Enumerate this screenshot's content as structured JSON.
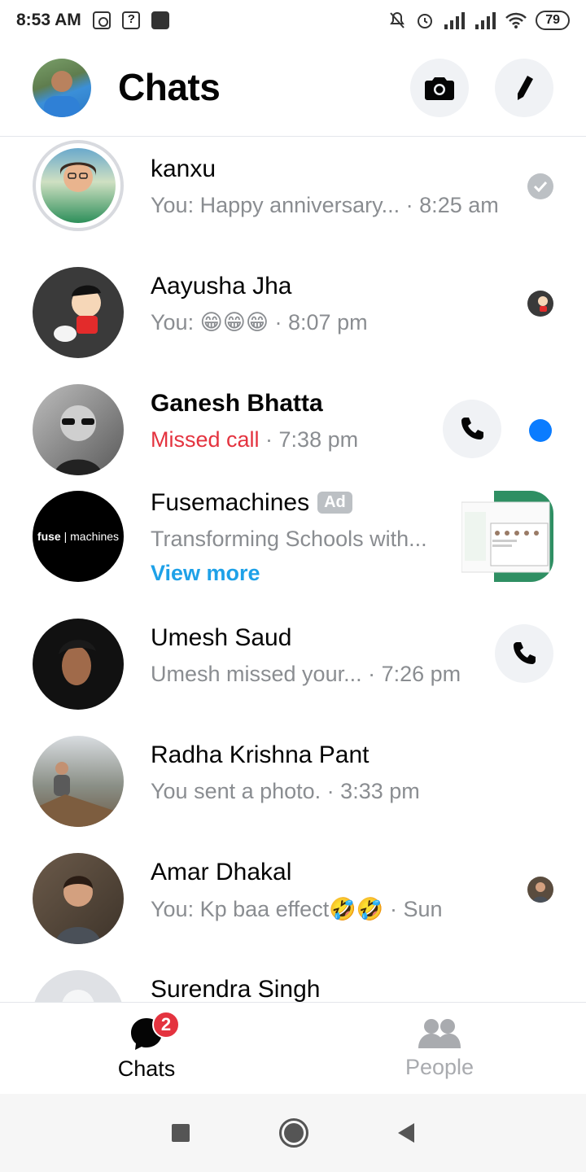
{
  "status_bar": {
    "time": "8:53 AM",
    "battery": "79",
    "icons": [
      "instagram-icon",
      "maps-icon",
      "game-icon",
      "mute-icon",
      "alarm-icon",
      "signal-icon",
      "signal-icon",
      "wifi-icon",
      "battery-icon"
    ]
  },
  "header": {
    "title": "Chats",
    "camera_icon": "camera-icon",
    "compose_icon": "pencil-icon"
  },
  "chats": [
    {
      "name": "kanxu",
      "preview": "You: Happy anniversary... · 8:25 am",
      "indicator": "seen-check-icon"
    },
    {
      "name": "Aayusha Jha",
      "preview_prefix": "You: ",
      "emoji": "😁😁😁",
      "preview_suffix": " · 8:07 pm",
      "indicator": "seen-avatar"
    },
    {
      "name": "Ganesh Bhatta",
      "missed": "Missed call",
      "preview_suffix": " · 7:38 pm",
      "indicator": "unread-dot",
      "action": "phone-icon"
    },
    {
      "name": "Fusemachines",
      "ad_badge": "Ad",
      "preview": "Transforming Schools with...",
      "link": "View more",
      "avatar_text_bold": "fuse",
      "avatar_text": "machines"
    },
    {
      "name": "Umesh Saud",
      "preview": "Umesh missed your...  · 7:26 pm",
      "action": "phone-icon"
    },
    {
      "name": "Radha Krishna Pant",
      "preview": "You sent a photo. · 3:33 pm"
    },
    {
      "name": "Amar Dhakal",
      "preview_prefix": "You: Kp baa effect",
      "emoji": "🤣🤣",
      "preview_suffix": " · Sun",
      "indicator": "seen-avatar"
    },
    {
      "name": "Surendra Singh"
    }
  ],
  "bottom_nav": {
    "tabs": [
      {
        "label": "Chats",
        "icon": "chat-bubble-icon",
        "badge": "2"
      },
      {
        "label": "People",
        "icon": "people-icon"
      }
    ]
  },
  "colors": {
    "accent": "#0a7cff",
    "missed": "#e4333f",
    "link": "#1ea1e8",
    "muted": "#8a8d91"
  }
}
